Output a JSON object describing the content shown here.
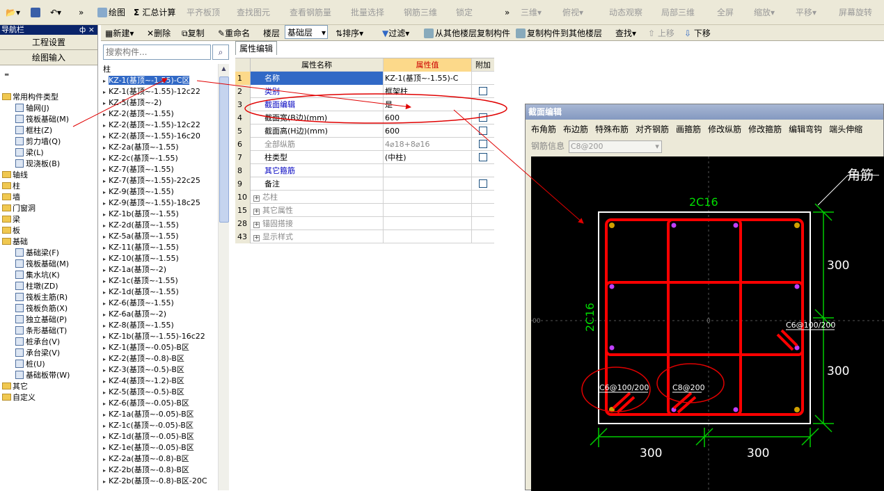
{
  "toolbar1": {
    "items": [
      "绘图",
      "汇总计算",
      "平齐板顶",
      "查找图元",
      "查看钢筋量",
      "批量选择",
      "钢筋三维",
      "锁定",
      "三维",
      "俯视",
      "动态观察",
      "局部三维",
      "全屏",
      "缩放",
      "平移",
      "屏幕旋转"
    ],
    "overflow": "»"
  },
  "nav": {
    "title": "导航栏",
    "pin": "ф ×",
    "btn_project": "工程设置",
    "btn_draw": "绘图输入",
    "tree": [
      {
        "label": "常用构件类型",
        "level": 0,
        "type": "folder"
      },
      {
        "label": "轴网(J)",
        "level": 1,
        "type": "comp"
      },
      {
        "label": "筏板基础(M)",
        "level": 1,
        "type": "comp"
      },
      {
        "label": "框柱(Z)",
        "level": 1,
        "type": "comp"
      },
      {
        "label": "剪力墙(Q)",
        "level": 1,
        "type": "comp"
      },
      {
        "label": "梁(L)",
        "level": 1,
        "type": "comp"
      },
      {
        "label": "现浇板(B)",
        "level": 1,
        "type": "comp"
      },
      {
        "label": "轴线",
        "level": 0,
        "type": "folder"
      },
      {
        "label": "柱",
        "level": 0,
        "type": "folder"
      },
      {
        "label": "墙",
        "level": 0,
        "type": "folder"
      },
      {
        "label": "门窗洞",
        "level": 0,
        "type": "folder"
      },
      {
        "label": "梁",
        "level": 0,
        "type": "folder"
      },
      {
        "label": "板",
        "level": 0,
        "type": "folder"
      },
      {
        "label": "基础",
        "level": 0,
        "type": "folder"
      },
      {
        "label": "基础梁(F)",
        "level": 1,
        "type": "comp"
      },
      {
        "label": "筏板基础(M)",
        "level": 1,
        "type": "comp"
      },
      {
        "label": "集水坑(K)",
        "level": 1,
        "type": "comp"
      },
      {
        "label": "柱墩(ZD)",
        "level": 1,
        "type": "comp"
      },
      {
        "label": "筏板主筋(R)",
        "level": 1,
        "type": "comp"
      },
      {
        "label": "筏板负筋(X)",
        "level": 1,
        "type": "comp"
      },
      {
        "label": "独立基础(P)",
        "level": 1,
        "type": "comp"
      },
      {
        "label": "条形基础(T)",
        "level": 1,
        "type": "comp"
      },
      {
        "label": "桩承台(V)",
        "level": 1,
        "type": "comp"
      },
      {
        "label": "承台梁(V)",
        "level": 1,
        "type": "comp"
      },
      {
        "label": "桩(U)",
        "level": 1,
        "type": "comp"
      },
      {
        "label": "基础板带(W)",
        "level": 1,
        "type": "comp"
      },
      {
        "label": "其它",
        "level": 0,
        "type": "folder"
      },
      {
        "label": "自定义",
        "level": 0,
        "type": "folder"
      }
    ]
  },
  "toolbar2": {
    "new": "新建",
    "delete": "删除",
    "copy": "复制",
    "rename": "重命名",
    "floor_label": "楼层",
    "floor_value": "基础层",
    "sort": "排序",
    "filter": "过滤",
    "copy_from": "从其他楼层复制构件",
    "copy_to": "复制构件到其他楼层",
    "find": "查找",
    "up": "上移",
    "down": "下移"
  },
  "list": {
    "search_placeholder": "搜索构件...",
    "group": "柱",
    "items": [
      "KZ-1(基顶~-1.55)-C区",
      "KZ-1(基顶~-1.55)-12c22",
      "KZ-5(基顶~-2)",
      "KZ-2(基顶~-1.55)",
      "KZ-2(基顶~-1.55)-12c22",
      "KZ-2(基顶~-1.55)-16c20",
      "KZ-2a(基顶~-1.55)",
      "KZ-2c(基顶~-1.55)",
      "KZ-7(基顶~-1.55)",
      "KZ-7(基顶~-1.55)-22c25",
      "KZ-9(基顶~-1.55)",
      "KZ-9(基顶~-1.55)-18c25",
      "KZ-1b(基顶~-1.55)",
      "KZ-2d(基顶~-1.55)",
      "KZ-5a(基顶~-1.55)",
      "KZ-11(基顶~-1.55)",
      "KZ-10(基顶~-1.55)",
      "KZ-1a(基顶~-2)",
      "KZ-1c(基顶~-1.55)",
      "KZ-1d(基顶~-1.55)",
      "KZ-6(基顶~-1.55)",
      "KZ-6a(基顶~-2)",
      "KZ-8(基顶~-1.55)",
      "KZ-1b(基顶~-1.55)-16c22",
      "KZ-1(基顶~-0.05)-B区",
      "KZ-2(基顶~-0.8)-B区",
      "KZ-3(基顶~-0.5)-B区",
      "KZ-4(基顶~-1.2)-B区",
      "KZ-5(基顶~-0.5)-B区",
      "KZ-6(基顶~-0.05)-B区",
      "KZ-1a(基顶~-0.05)-B区",
      "KZ-1c(基顶~-0.05)-B区",
      "KZ-1d(基顶~-0.05)-B区",
      "KZ-1e(基顶~-0.05)-B区",
      "KZ-2a(基顶~-0.8)-B区",
      "KZ-2b(基顶~-0.8)-B区",
      "KZ-2b(基顶~-0.8)-B区-20C"
    ]
  },
  "props": {
    "tab": "属性编辑",
    "col_name": "属性名称",
    "col_value": "属性值",
    "col_extra": "附加",
    "rows": [
      {
        "num": "1",
        "name": "名称",
        "value": "KZ-1(基顶~-1.55)-C",
        "style": "sel",
        "check": false
      },
      {
        "num": "2",
        "name": "类别",
        "value": "框架柱",
        "style": "blue",
        "check": true
      },
      {
        "num": "3",
        "name": "截面编辑",
        "value": "是",
        "style": "blue",
        "check": false
      },
      {
        "num": "4",
        "name": "截面宽(B边)(mm)",
        "value": "600",
        "style": "",
        "check": true
      },
      {
        "num": "5",
        "name": "截面高(H边)(mm)",
        "value": "600",
        "style": "",
        "check": true
      },
      {
        "num": "6",
        "name": "全部纵筋",
        "value": "4⌀18+8⌀16",
        "style": "gray",
        "check": true
      },
      {
        "num": "7",
        "name": "柱类型",
        "value": "(中柱)",
        "style": "",
        "check": true
      },
      {
        "num": "8",
        "name": "其它箍筋",
        "value": "",
        "style": "blue",
        "check": false
      },
      {
        "num": "9",
        "name": "备注",
        "value": "",
        "style": "",
        "check": true
      },
      {
        "num": "10",
        "name": "芯柱",
        "value": "",
        "style": "grayplus",
        "check": false
      },
      {
        "num": "15",
        "name": "其它属性",
        "value": "",
        "style": "grayplus",
        "check": false
      },
      {
        "num": "28",
        "name": "锚固搭接",
        "value": "",
        "style": "grayplus",
        "check": false
      },
      {
        "num": "43",
        "name": "显示样式",
        "value": "",
        "style": "grayplus",
        "check": false
      }
    ]
  },
  "dialog": {
    "title": "截面编辑",
    "tools": [
      "布角筋",
      "布边筋",
      "特殊布筋",
      "对齐钢筋",
      "画箍筋",
      "修改纵筋",
      "修改箍筋",
      "编辑弯钩",
      "端头伸缩"
    ],
    "rebar_info_label": "钢筋信息",
    "rebar_info_value": "C8@200",
    "labels": {
      "corner": "角筋",
      "top": "2C16",
      "left": "2C16",
      "dim1": "300",
      "dim2": "300",
      "dim3": "300",
      "dim4": "300",
      "stir1": "C6@100/200",
      "stir2": "C8@200",
      "stir3": "C6@100/200"
    }
  },
  "colors": {
    "accent": "#3169c6",
    "rebar": "#ff0000",
    "dim": "#00cc00",
    "annotation": "#e00000"
  }
}
